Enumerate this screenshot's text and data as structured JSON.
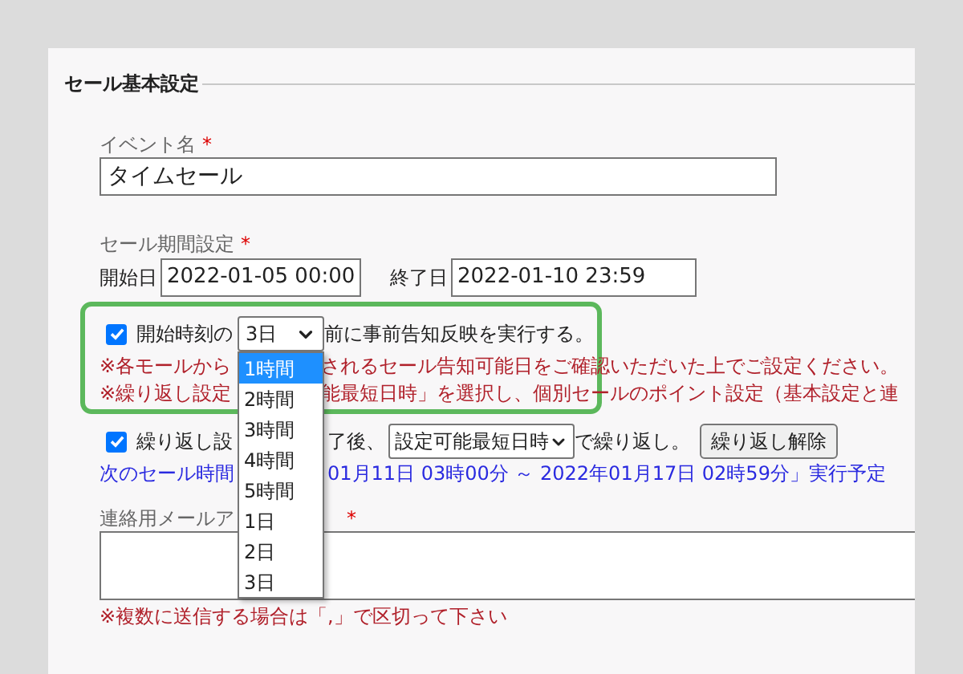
{
  "section": {
    "title": "セール基本設定"
  },
  "event_name": {
    "label": "イベント名",
    "required_mark": "*",
    "value": "タイムセール"
  },
  "period": {
    "label": "セール期間設定",
    "required_mark": "*",
    "start_label": "開始日",
    "start_value": "2022-01-05 00:00",
    "end_label": "終了日",
    "end_value": "2022-01-10 23:59"
  },
  "pre_notice": {
    "highlighted": true,
    "checked": true,
    "label_before": "開始時刻の",
    "select_value": "3日",
    "label_after": "前に事前告知反映を実行する。",
    "notes": [
      {
        "before": "※各モールから",
        "after": "されるセール告知可能日をご確認いただいた上でご設定ください。"
      },
      {
        "before": "※繰り返し設定",
        "after": "能最短日時」を選択し、個別セールのポイント設定（基本設定と連"
      }
    ]
  },
  "repeat": {
    "checked": true,
    "label_before": "繰り返し設",
    "label_after": "了後、",
    "select_value": "設定可能最短日時",
    "suffix": "で繰り返し。",
    "button": "繰り返し解除",
    "next_before": "次のセール時間",
    "next_after": "01月11日 03時00分 ～ 2022年01月17日 02時59分」実行予定"
  },
  "email": {
    "label": "連絡用メールア",
    "required_mark": "*",
    "note": "※複数に送信する場合は「,」で区切って下さい"
  },
  "dropdown": {
    "options": [
      {
        "label": "1時間",
        "selected": true
      },
      {
        "label": "2時間",
        "selected": false
      },
      {
        "label": "3時間",
        "selected": false
      },
      {
        "label": "4時間",
        "selected": false
      },
      {
        "label": "5時間",
        "selected": false
      },
      {
        "label": "1日",
        "selected": false
      },
      {
        "label": "2日",
        "selected": false
      },
      {
        "label": "3日",
        "selected": false
      }
    ]
  }
}
